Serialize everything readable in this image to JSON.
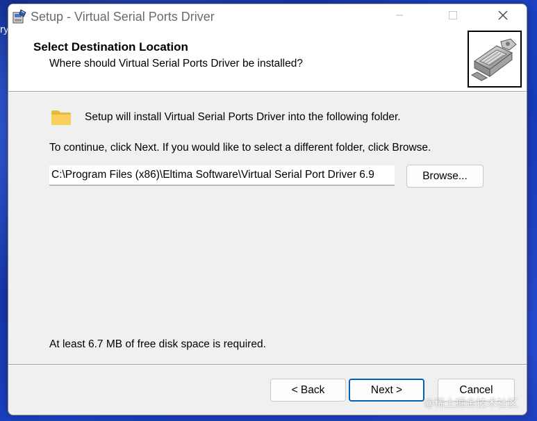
{
  "desktop": {
    "edge_text": "ry"
  },
  "window": {
    "title": "Setup - Virtual Serial Ports Driver",
    "icon": "setup-installer-icon"
  },
  "header": {
    "title": "Select Destination Location",
    "subtitle": "Where should Virtual Serial Ports Driver be installed?",
    "image": "serial-port-connector-image"
  },
  "body": {
    "intro": "Setup will install Virtual Serial Ports Driver into the following folder.",
    "instruction": "To continue, click Next. If you would like to select a different folder, click Browse.",
    "path_value": "C:\\Program Files (x86)\\Eltima Software\\Virtual Serial Port Driver 6.9",
    "browse_label": "Browse...",
    "disk_space": "At least 6.7 MB of free disk space is required."
  },
  "footer": {
    "back_label": "< Back",
    "next_label": "Next >",
    "cancel_label": "Cancel"
  },
  "watermark": "@稀土掘金技术社区",
  "colors": {
    "accent": "#005fb8",
    "folder": "#f5c542",
    "window_bg": "#f0f0f0"
  }
}
